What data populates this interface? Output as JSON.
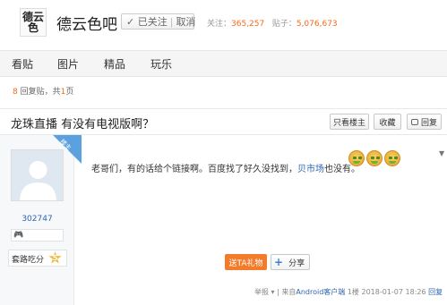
{
  "header": {
    "logo_text": "德云色",
    "forum_name": "德云色吧",
    "follow_label": "✓ 已关注",
    "unfollow_label": "取消",
    "stats_follow_label": "关注：",
    "stats_follow_value": "365,257",
    "stats_posts_label": "贴子：",
    "stats_posts_value": "5,076,673"
  },
  "nav": {
    "items": [
      {
        "label": "看贴"
      },
      {
        "label": "图片"
      },
      {
        "label": "精品"
      },
      {
        "label": "玩乐"
      }
    ]
  },
  "thread": {
    "reply_count": "8",
    "reply_count_suffix": " 回复贴，共",
    "page_count": "1",
    "page_count_suffix": "页",
    "title": "龙珠直播 有没有电视版啊？",
    "only_op_label": "只看楼主",
    "favorite_label": "收藏",
    "reply_label": "回复"
  },
  "post": {
    "ribbon_label": "楼主",
    "author": {
      "username": "302747",
      "level_name": "套路吃分",
      "level_number": "5"
    },
    "content_text": "老哥们，有的话给个链接啊。百度找了好久没找到，",
    "content_link": "贝市场",
    "content_tail": "也没有。",
    "gift_label": "送TA礼物",
    "share_label": "分享",
    "meta": {
      "report": "举报",
      "separator": "|",
      "from_prefix": "来自",
      "client": "Android客户端",
      "floor": "1楼",
      "time": "2018-01-07 18:26",
      "reply": "回复"
    }
  },
  "colors": {
    "accent_orange": "#f36a1a",
    "link_blue": "#2d64b3",
    "gift_orange": "#f47b2a",
    "ribbon_blue": "#5ba0df"
  }
}
